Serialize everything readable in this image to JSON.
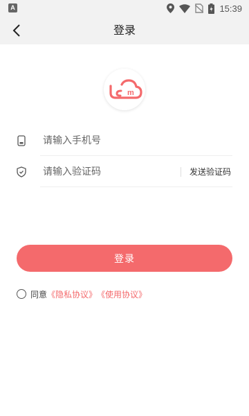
{
  "status_bar": {
    "time": "15:39",
    "left_icon_letter": "A",
    "icons": [
      "location-icon",
      "wifi-icon",
      "no-sim-icon",
      "battery-charging-icon"
    ]
  },
  "header": {
    "title": "登录",
    "back_icon": "chevron-left-icon"
  },
  "logo": {
    "text": "m",
    "icon": "cloud-logo-icon",
    "color": "#f46a6c"
  },
  "form": {
    "phone": {
      "placeholder": "请输入手机号",
      "value": "",
      "icon": "phone-icon"
    },
    "code": {
      "placeholder": "请输入验证码",
      "value": "",
      "icon": "shield-icon"
    },
    "send_code_label": "发送验证码"
  },
  "login_button": {
    "label": "登录"
  },
  "agreement": {
    "prefix": "同意",
    "privacy": "《隐私协议》",
    "terms": "《使用协议》"
  },
  "colors": {
    "accent": "#f46a6c",
    "header_bg": "#f2f2f2"
  }
}
